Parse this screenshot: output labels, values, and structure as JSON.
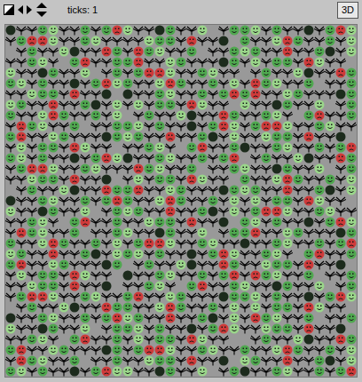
{
  "toolbar": {
    "ticks": "ticks: 1",
    "button_3d": "3D"
  },
  "view": {
    "rows": [
      "KTTGLTTGTGRLTTKGTTL.TGGLTGTTKTGRL",
      "TGRRLTTGLTTTTLGGTRTTK.GTTLRGTTGTL",
      ".TGTTLKTTRGTRGLTTG.TTGLGTTRTTGKTL",
      "TTGLT.GRTTGGRTTLGTTTKGTLTGGTRLTT.",
      "LTTKGTTL.TGTGRRLTTGLTT.TGTTLKTTRG",
      "GLTGTTKTGRLGTTLRGTTGTLTRGLTTG.TTG",
      "TTLGGTRTTK.KTTGLTTGTGRGRTTLGTTTKG",
      "LGTTRTTGKTLTLTGGTRLTT.LTTKGTTL.TG",
      "GTTLRGTTGTL.TGTTLKTTRGTTGLT.GRTTG",
      "TRGLTTG.TTGGLTGTTKTGRLTGRRLTTGLTT",
      "GRTTLGTTTKGLGTTRTTGKTLTTLGGTRTTK.",
      "TLTGGTRLTT.TTGLT.GRTTGKTTGLTTGTGR",
      "GLTGTTKTGRLKTTGLTTGTGR.TGTTLKTTRG",
      "TGRRLTTGLTTTRGLTTG.TTGLTTKGTTL.TG",
      "TTLGGTRTTK.TLTGGTRLTT.GTTLRGTTGTL",
      ".TGTTLKTTRGGRTTLGTTTKGLGTTRTTGKTL",
      "KTTGLTTGTGRGTTLRGTTGTLTLTGGTRLTT.",
      "LTTKGTTL.TGLGTTRTTGKTLTGRRLTTGLTT",
      "TTGLT.GRTTGTTLGGTRTTK.GLTGTTKTGRL",
      "TRGLTTG.TTGLTTKGTTL.TGGRTTLGTTTKG",
      "GTTLRGTTGTLTGRRLTTGLTTKTTGLTTGTGR",
      "LGTTRTTGKTLGLTGTTKTGRLTTGLT.GRTTG",
      "GRTTLGTTTKG.TGTTLKTTRGTTLGGTRTTK.",
      "TLTGGTRLTT.KTTGLTTGTGRTRGLTTG.TTG",
      "TTLGGTRTTK.TTGLT.GRTTGLTTKGTTL.TG",
      "TGRRLTTGLTTGRTTLGTTTKGGLTGTTKTGRL",
      ".TGTTLKTTRGGTTLRGTTGTLTLTGGTRLTT.",
      "KTTGLTTGTGRLGTTRTTGKTLTRGLTTG.TTG",
      "LTTKGTTL.TGGLTGTTKTGRLTTLGGTRTTK.",
      "TTGLT.GRTTGTLTGGTRLTT..TGTTLKTTRG",
      "GRTTLGTTTKGTGRRLTTGLTTGTTLRGTTGTL",
      "TRGLTTG.TTGTTLGGTRTTK.LGTTRTTGKTL",
      "GLTGTTKTGRLLTTKGTTL.TGKTTGLTTGTGR"
    ]
  }
}
